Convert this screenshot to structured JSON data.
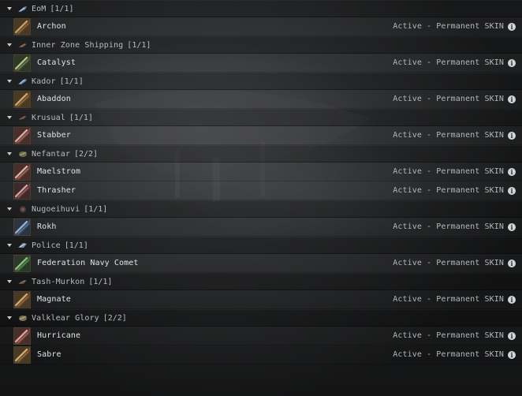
{
  "colors": {
    "background": "#2a2b2c",
    "group_header_text": "#b7bcc1",
    "item_name_text": "#e1e4e7",
    "status_text": "#b3b8bd",
    "info_icon": "#d3d6d9"
  },
  "groups": [
    {
      "title": "EoM",
      "count": "[1/1]",
      "icon": "eom-faction-icon",
      "items": [
        {
          "name": "Archon",
          "status": "Active - Permanent SKIN",
          "thumb": "archon-thumbnail"
        }
      ]
    },
    {
      "title": "Inner Zone Shipping",
      "count": "[1/1]",
      "icon": "inner-zone-shipping-faction-icon",
      "items": [
        {
          "name": "Catalyst",
          "status": "Active - Permanent SKIN",
          "thumb": "catalyst-thumbnail"
        }
      ]
    },
    {
      "title": "Kador",
      "count": "[1/1]",
      "icon": "kador-faction-icon",
      "items": [
        {
          "name": "Abaddon",
          "status": "Active - Permanent SKIN",
          "thumb": "abaddon-thumbnail"
        }
      ]
    },
    {
      "title": "Krusual",
      "count": "[1/1]",
      "icon": "krusual-faction-icon",
      "items": [
        {
          "name": "Stabber",
          "status": "Active - Permanent SKIN",
          "thumb": "stabber-thumbnail"
        }
      ]
    },
    {
      "title": "Nefantar",
      "count": "[2/2]",
      "icon": "nefantar-faction-icon",
      "items": [
        {
          "name": "Maelstrom",
          "status": "Active - Permanent SKIN",
          "thumb": "maelstrom-thumbnail"
        },
        {
          "name": "Thrasher",
          "status": "Active - Permanent SKIN",
          "thumb": "thrasher-thumbnail"
        }
      ]
    },
    {
      "title": "Nugoeihuvi",
      "count": "[1/1]",
      "icon": "nugoeihuvi-faction-icon",
      "items": [
        {
          "name": "Rokh",
          "status": "Active - Permanent SKIN",
          "thumb": "rokh-thumbnail"
        }
      ]
    },
    {
      "title": "Police",
      "count": "[1/1]",
      "icon": "police-faction-icon",
      "items": [
        {
          "name": "Federation Navy Comet",
          "status": "Active - Permanent SKIN",
          "thumb": "federation-navy-comet-thumbnail"
        }
      ]
    },
    {
      "title": "Tash-Murkon",
      "count": "[1/1]",
      "icon": "tash-murkon-faction-icon",
      "items": [
        {
          "name": "Magnate",
          "status": "Active - Permanent SKIN",
          "thumb": "magnate-thumbnail"
        }
      ]
    },
    {
      "title": "Valklear Glory",
      "count": "[2/2]",
      "icon": "valklear-glory-faction-icon",
      "items": [
        {
          "name": "Hurricane",
          "status": "Active - Permanent SKIN",
          "thumb": "hurricane-thumbnail"
        },
        {
          "name": "Sabre",
          "status": "Active - Permanent SKIN",
          "thumb": "sabre-thumbnail"
        }
      ]
    }
  ]
}
